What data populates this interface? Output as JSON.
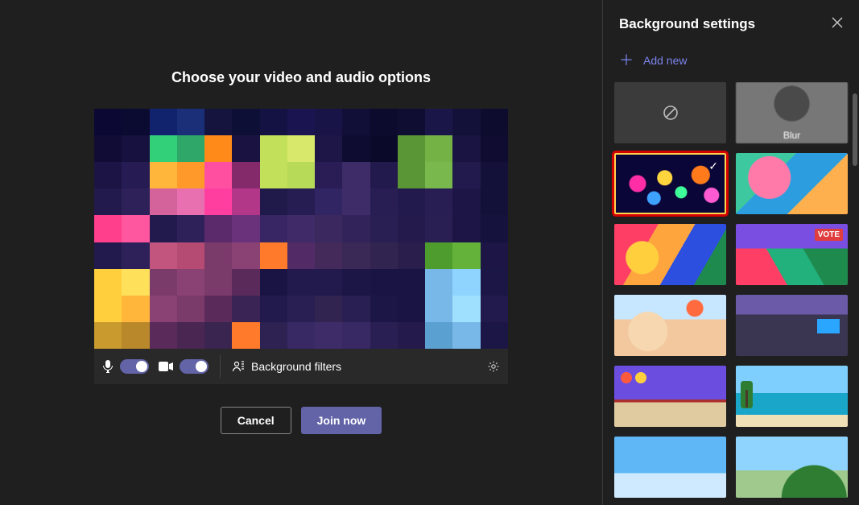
{
  "main": {
    "title": "Choose your video and audio options",
    "filters_label": "Background filters",
    "cancel": "Cancel",
    "join": "Join now"
  },
  "panel": {
    "title": "Background settings",
    "add_new": "Add new"
  },
  "tiles": {
    "blur_label": "Blur"
  },
  "pixel_colors": [
    "#0c0834",
    "#0b0a31",
    "#12236e",
    "#1a2f77",
    "#15143f",
    "#0e0f36",
    "#141243",
    "#1a1550",
    "#191447",
    "#110f38",
    "#0c0b2d",
    "#100d33",
    "#1a1748",
    "#13113a",
    "#0d0b2e",
    "#110c36",
    "#16113f",
    "#33d07a",
    "#2ea768",
    "#ff8a1a",
    "#1a1342",
    "#c3e05a",
    "#d8e86a",
    "#1e1647",
    "#0f0c31",
    "#0b0929",
    "#5a9636",
    "#74b246",
    "#1a1442",
    "#100c31",
    "#1b1444",
    "#261b53",
    "#ffb63a",
    "#ff9a2a",
    "#ff4fa0",
    "#842a6b",
    "#c3e05a",
    "#b7da58",
    "#2a1d55",
    "#3e2c68",
    "#221a4c",
    "#5a9636",
    "#78b84c",
    "#221a4c",
    "#13103a",
    "#221a4c",
    "#2e2159",
    "#d4639b",
    "#e86fb0",
    "#ff3ea0",
    "#b23788",
    "#201a4a",
    "#261d52",
    "#322564",
    "#3e2c68",
    "#281e54",
    "#221a4c",
    "#281e54",
    "#1c1546",
    "#13103a",
    "#ff3e8c",
    "#ff56a0",
    "#221a4c",
    "#2e2159",
    "#5a2a6b",
    "#6a327a",
    "#382664",
    "#402b68",
    "#3a285e",
    "#32245a",
    "#2a1f52",
    "#241b4c",
    "#2a1f52",
    "#1c1546",
    "#15123e",
    "#221a4c",
    "#2e2159",
    "#c2557e",
    "#b54a72",
    "#7a3a6a",
    "#8a4274",
    "#ff7a2a",
    "#522b66",
    "#442a5a",
    "#3a2856",
    "#322450",
    "#2a1f4c",
    "#4f9c2e",
    "#64b23a",
    "#1c1546",
    "#ffcf3e",
    "#ffe05a",
    "#7a3a6a",
    "#8a4274",
    "#7a3a6a",
    "#5a2a5a",
    "#1a1444",
    "#221a4c",
    "#221a4c",
    "#1c1646",
    "#1a1444",
    "#1a1444",
    "#78b8e8",
    "#8fd4ff",
    "#1c1646",
    "#ffcf3e",
    "#ffb63a",
    "#8a4274",
    "#7a3a6a",
    "#5a2a5a",
    "#3a2456",
    "#221a4c",
    "#2a1f52",
    "#322450",
    "#2a1f52",
    "#1c1646",
    "#1a1444",
    "#78b8e8",
    "#a0e0ff",
    "#221a4c",
    "#c99a2e",
    "#b8882a",
    "#5a2a5a",
    "#4a2652",
    "#3a2450",
    "#ff7a2a",
    "#2e2252",
    "#382864",
    "#3e2c68",
    "#382864",
    "#2a1f52",
    "#241b4c",
    "#5aa0d0",
    "#78b8e8",
    "#1c1646"
  ]
}
